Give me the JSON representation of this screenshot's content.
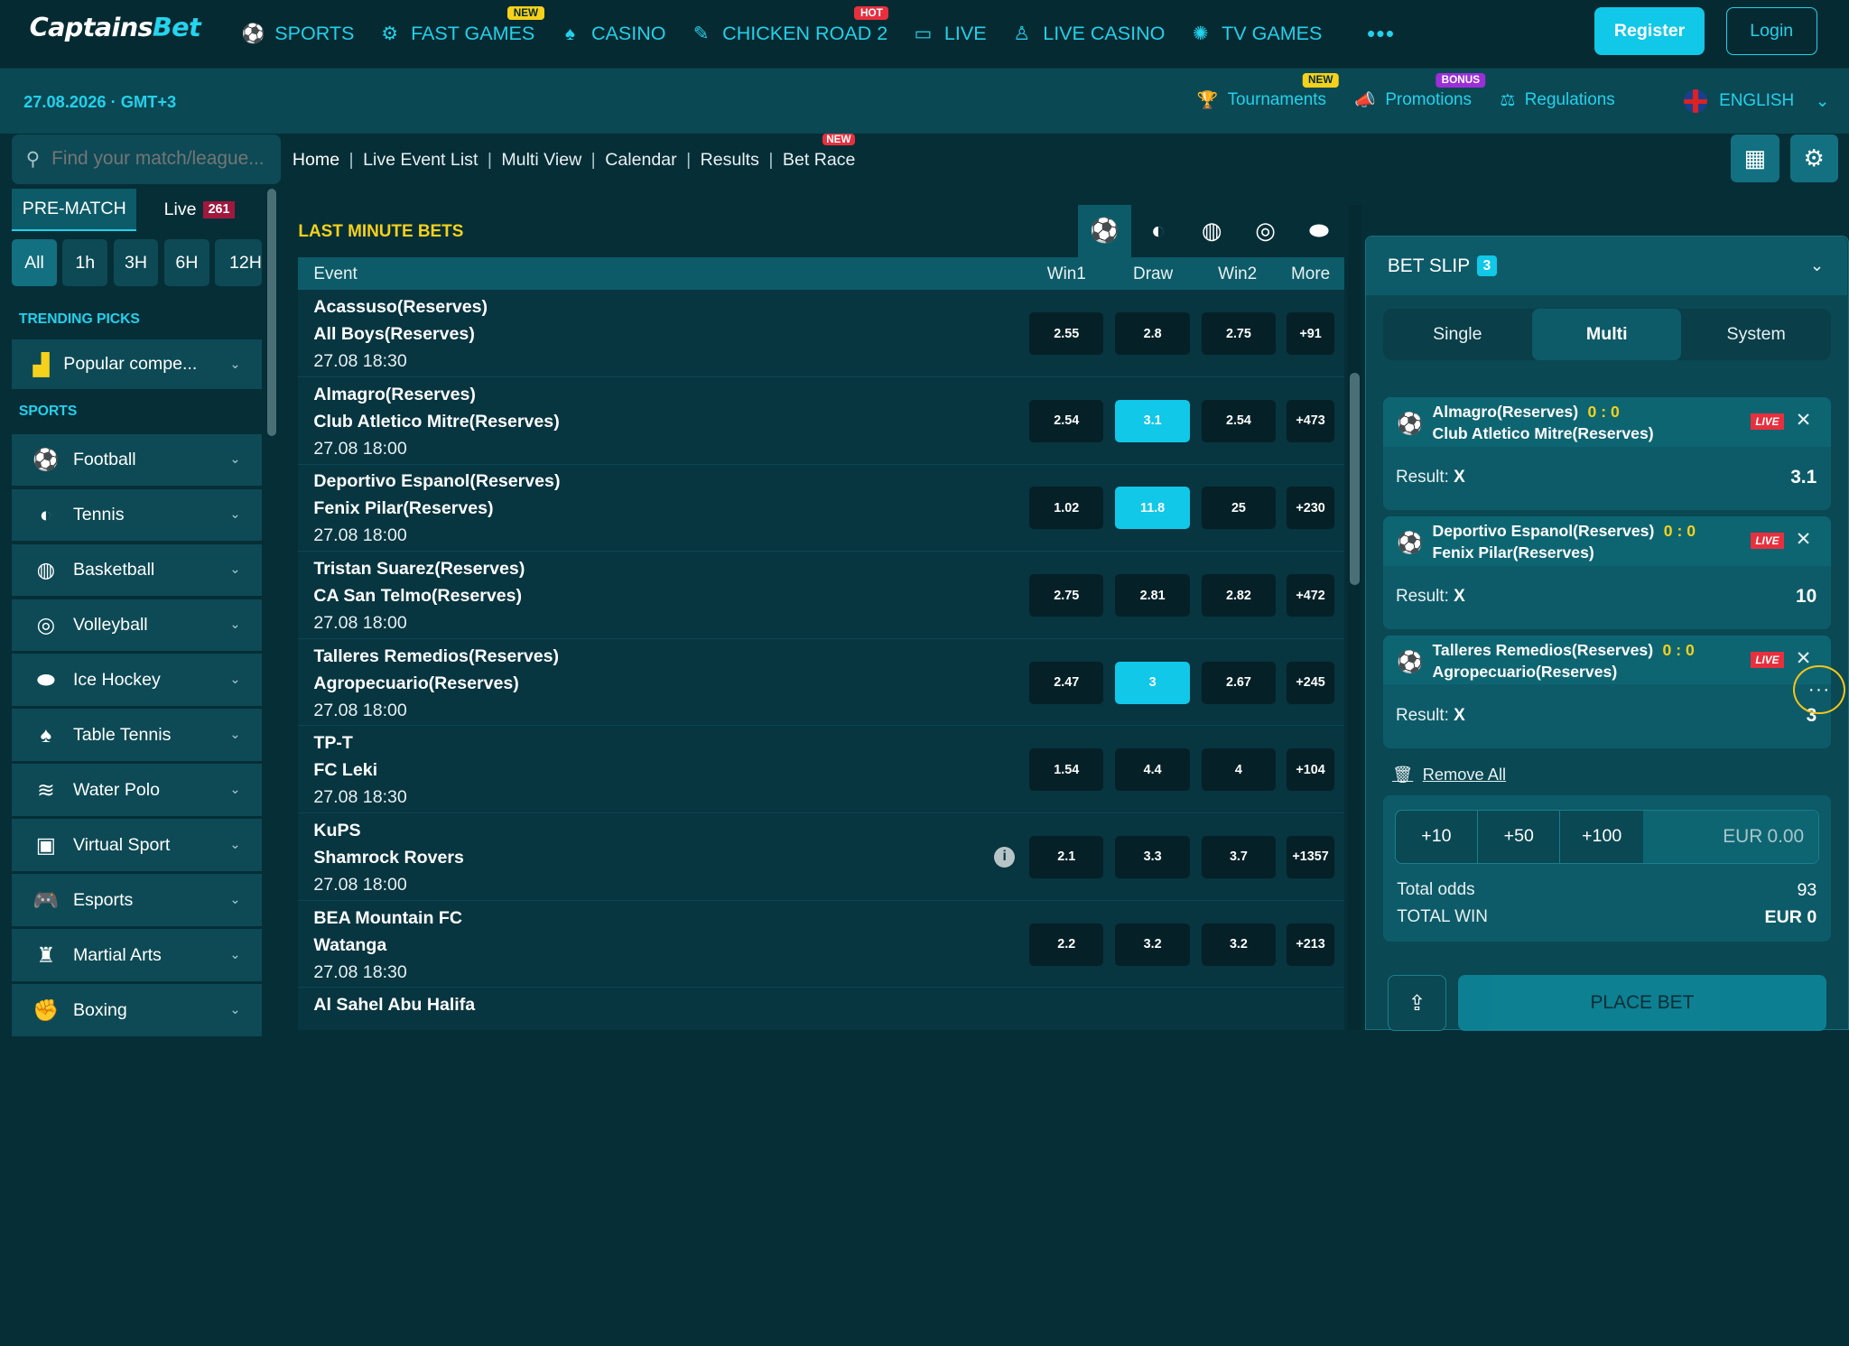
{
  "brand": {
    "logo_a": "Captains",
    "logo_b": "Bet"
  },
  "nav": [
    {
      "label": "SPORTS",
      "icon": "soccer-ball-icon",
      "badge": ""
    },
    {
      "label": "FAST GAMES",
      "icon": "fast-games-icon",
      "badge": "NEW"
    },
    {
      "label": "CASINO",
      "icon": "casino-icon",
      "badge": ""
    },
    {
      "label": "CHICKEN ROAD 2",
      "icon": "chicken-icon",
      "badge": "HOT"
    },
    {
      "label": "LIVE",
      "icon": "live-icon",
      "badge": ""
    },
    {
      "label": "LIVE CASINO",
      "icon": "dealer-icon",
      "badge": ""
    },
    {
      "label": "TV GAMES",
      "icon": "tv-games-icon",
      "badge": ""
    }
  ],
  "auth": {
    "register": "Register",
    "login": "Login"
  },
  "subbar": {
    "datetime": "27.08.2026 · GMT+3",
    "tournaments": "Tournaments",
    "tournaments_badge": "NEW",
    "promotions": "Promotions",
    "promotions_badge": "BONUS",
    "regulations": "Regulations",
    "language": "ENGLISH"
  },
  "sidebar": {
    "search_placeholder": "Find your match/league...",
    "tab_prematch": "PRE-MATCH",
    "tab_live": "Live",
    "live_count": "261",
    "time_filters": [
      "All",
      "1h",
      "3H",
      "6H",
      "12H"
    ],
    "trending_title": "TRENDING PICKS",
    "popular": "Popular compe...",
    "sports_title": "SPORTS",
    "sports": [
      "Football",
      "Tennis",
      "Basketball",
      "Volleyball",
      "Ice Hockey",
      "Table Tennis",
      "Water Polo",
      "Virtual Sport",
      "Esports",
      "Martial Arts",
      "Boxing"
    ]
  },
  "breadcrumbs": [
    "Home",
    "Live Event List",
    "Multi View",
    "Calendar",
    "Results",
    "Bet Race"
  ],
  "breadcrumb_badge": "NEW",
  "lastminute": {
    "title": "LAST MINUTE BETS",
    "headers": {
      "event": "Event",
      "win1": "Win1",
      "draw": "Draw",
      "win2": "Win2",
      "more": "More"
    },
    "rows": [
      {
        "t1": "Acassuso(Reserves)",
        "t2": "All Boys(Reserves)",
        "dt": "27.08 18:30",
        "w1": "2.55",
        "d": "2.8",
        "w2": "2.75",
        "more": "+91"
      },
      {
        "t1": "Almagro(Reserves)",
        "t2": "Club Atletico Mitre(Reserves)",
        "dt": "27.08 18:00",
        "w1": "2.54",
        "d": "3.1",
        "w2": "2.54",
        "more": "+473"
      },
      {
        "t1": "Deportivo Espanol(Reserves)",
        "t2": "Fenix Pilar(Reserves)",
        "dt": "27.08 18:00",
        "w1": "1.02",
        "d": "11.8",
        "w2": "25",
        "more": "+230"
      },
      {
        "t1": "Tristan Suarez(Reserves)",
        "t2": "CA San Telmo(Reserves)",
        "dt": "27.08 18:00",
        "w1": "2.75",
        "d": "2.81",
        "w2": "2.82",
        "more": "+472"
      },
      {
        "t1": "Talleres Remedios(Reserves)",
        "t2": "Agropecuario(Reserves)",
        "dt": "27.08 18:00",
        "w1": "2.47",
        "d": "3",
        "w2": "2.67",
        "more": "+245"
      },
      {
        "t1": "TP-T",
        "t2": "FC Leki",
        "dt": "27.08 18:30",
        "w1": "1.54",
        "d": "4.4",
        "w2": "4",
        "more": "+104"
      },
      {
        "t1": "KuPS",
        "t2": "Shamrock Rovers",
        "dt": "27.08 18:00",
        "w1": "2.1",
        "d": "3.3",
        "w2": "3.7",
        "more": "+1357"
      },
      {
        "t1": "BEA Mountain FC",
        "t2": "Watanga",
        "dt": "27.08 18:30",
        "w1": "2.2",
        "d": "3.2",
        "w2": "3.2",
        "more": "+213"
      },
      {
        "t1": "Al Sahel Abu Halifa",
        "t2": "",
        "dt": "",
        "w1": "",
        "d": "",
        "w2": "",
        "more": ""
      }
    ]
  },
  "betslip": {
    "title": "BET SLIP",
    "count": "3",
    "tabs": [
      "Single",
      "Multi",
      "System"
    ],
    "bets": [
      {
        "t1": "Almagro(Reserves)",
        "score": "0 : 0",
        "t2": "Club Atletico Mitre(Reserves)",
        "live": "LIVE",
        "result_label": "Result:",
        "result": "X",
        "odd": "3.1"
      },
      {
        "t1": "Deportivo Espanol(Reserves)",
        "score": "0 : 0",
        "t2": "Fenix Pilar(Reserves)",
        "live": "LIVE",
        "result_label": "Result:",
        "result": "X",
        "odd": "10"
      },
      {
        "t1": "Talleres Remedios(Reserves)",
        "score": "0 : 0",
        "t2": "Agropecuario(Reserves)",
        "live": "LIVE",
        "result_label": "Result:",
        "result": "X",
        "odd": "3"
      }
    ],
    "remove_all": "Remove All",
    "quick": [
      "+10",
      "+50",
      "+100"
    ],
    "currency": "EUR",
    "stake": "0.00",
    "total_odds_label": "Total odds",
    "total_odds": "93",
    "total_win_label": "TOTAL WIN",
    "total_win": "EUR 0",
    "place_bet": "PLACE BET"
  },
  "colors": {
    "accent": "#11c8e8",
    "highlight": "#f5d11b",
    "live": "#e7303e",
    "background": "#062e37"
  }
}
